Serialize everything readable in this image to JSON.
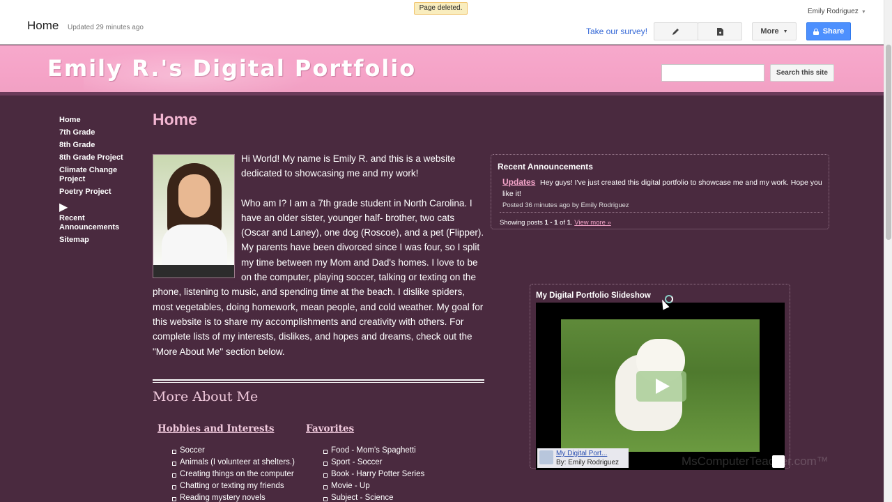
{
  "topbar": {
    "page_title": "Home",
    "updated": "Updated 29 minutes ago",
    "toast": "Page deleted.",
    "user": "Emily Rodriguez",
    "survey_link": "Take our survey!",
    "more_label": "More",
    "share_label": "Share"
  },
  "header": {
    "site_title": "Emily R.'s Digital Portfolio",
    "search_value": "",
    "search_button": "Search this site"
  },
  "sidebar": {
    "items": [
      {
        "label": "Home"
      },
      {
        "label": "7th Grade"
      },
      {
        "label": "8th Grade"
      },
      {
        "label": "8th Grade Project"
      },
      {
        "label": "Climate Change Project"
      },
      {
        "label": "Poetry Project"
      },
      {
        "label": "Recent Announcements"
      },
      {
        "label": "Sitemap"
      }
    ]
  },
  "main": {
    "title": "Home",
    "intro_p1": "Hi World!  My name is Emily R. and this is a website dedicated to showcasing me and my work!",
    "intro_p2": "Who am I?  I am a 7th grade student in North Carolina.  I have an older sister, younger half- brother, two cats (Oscar and Laney), one dog (Roscoe), and a pet (Flipper).  My parents have been divorced since I was four, so I split my time between my Mom and Dad's homes.  I love to be on the computer, playing soccer, talking or texting on the phone, listening to music, and spending time at the beach.  I dislike spiders, most vegetables, doing homework, mean people, and cold weather.  My goal for this website is to share my accomplishments and creativity with others.  For complete lists of my interests, dislikes, and hopes and dreams, check out the \"More About Me\" section below.",
    "more_about_title": "More About Me",
    "hobbies_title": "Hobbies and Interests",
    "hobbies": [
      "Soccer",
      "Animals (I volunteer at shelters.)",
      "Creating things on the computer",
      "Chatting or texting my friends",
      "Reading mystery novels"
    ],
    "favorites_title": "Favorites",
    "favorites": [
      "Food - Mom's Spaghetti",
      "Sport - Soccer",
      "Book - Harry Potter Series",
      "Movie - Up",
      "Subject - Science"
    ]
  },
  "announcements": {
    "title": "Recent Announcements",
    "post_title": "Updates",
    "post_body": "Hey guys! I've just created this digital portfolio to showcase me and my work.  Hope you like it!",
    "post_meta": "Posted 36 minutes ago by Emily Rodriguez",
    "showing_prefix": "Showing posts ",
    "showing_range": "1 - 1",
    "showing_of": " of ",
    "showing_total": "1",
    "showing_sep": ". ",
    "view_more": "View more »"
  },
  "slideshow": {
    "title": "My Digital Portfolio Slideshow",
    "caption_link": "My Digital Port...",
    "caption_by": "By: Emily Rodriguez"
  },
  "watermark": "MsComputerTeacher.com™"
}
